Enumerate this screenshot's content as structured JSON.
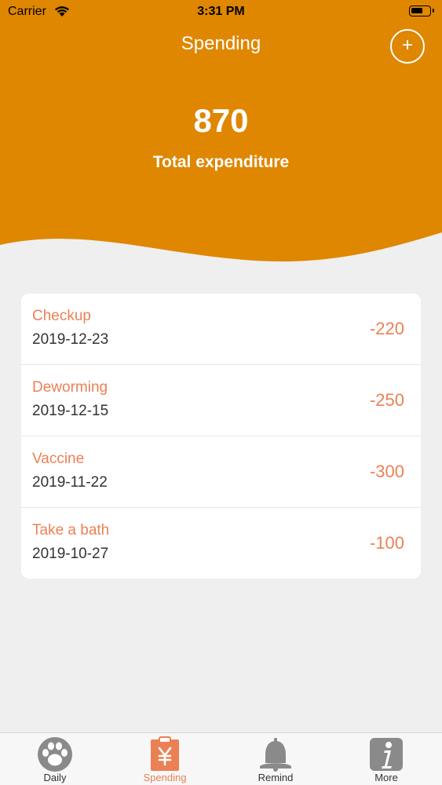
{
  "status_bar": {
    "carrier": "Carrier",
    "time": "3:31 PM"
  },
  "header": {
    "title": "Spending",
    "add_icon": "plus",
    "total_value": "870",
    "total_label": "Total expenditure"
  },
  "expenses": [
    {
      "title": "Checkup",
      "date": "2019-12-23",
      "amount": "-220"
    },
    {
      "title": "Deworming",
      "date": "2019-12-15",
      "amount": "-250"
    },
    {
      "title": "Vaccine",
      "date": "2019-11-22",
      "amount": "-300"
    },
    {
      "title": "Take a bath",
      "date": "2019-10-27",
      "amount": "-100"
    }
  ],
  "tabs": [
    {
      "label": "Daily",
      "icon": "paw-icon"
    },
    {
      "label": "Spending",
      "icon": "yuan-clipboard-icon"
    },
    {
      "label": "Remind",
      "icon": "bell-icon"
    },
    {
      "label": "More",
      "icon": "info-icon"
    }
  ],
  "active_tab": "Spending",
  "colors": {
    "header": "#df8700",
    "accent": "#ec8055",
    "background": "#efefef"
  }
}
